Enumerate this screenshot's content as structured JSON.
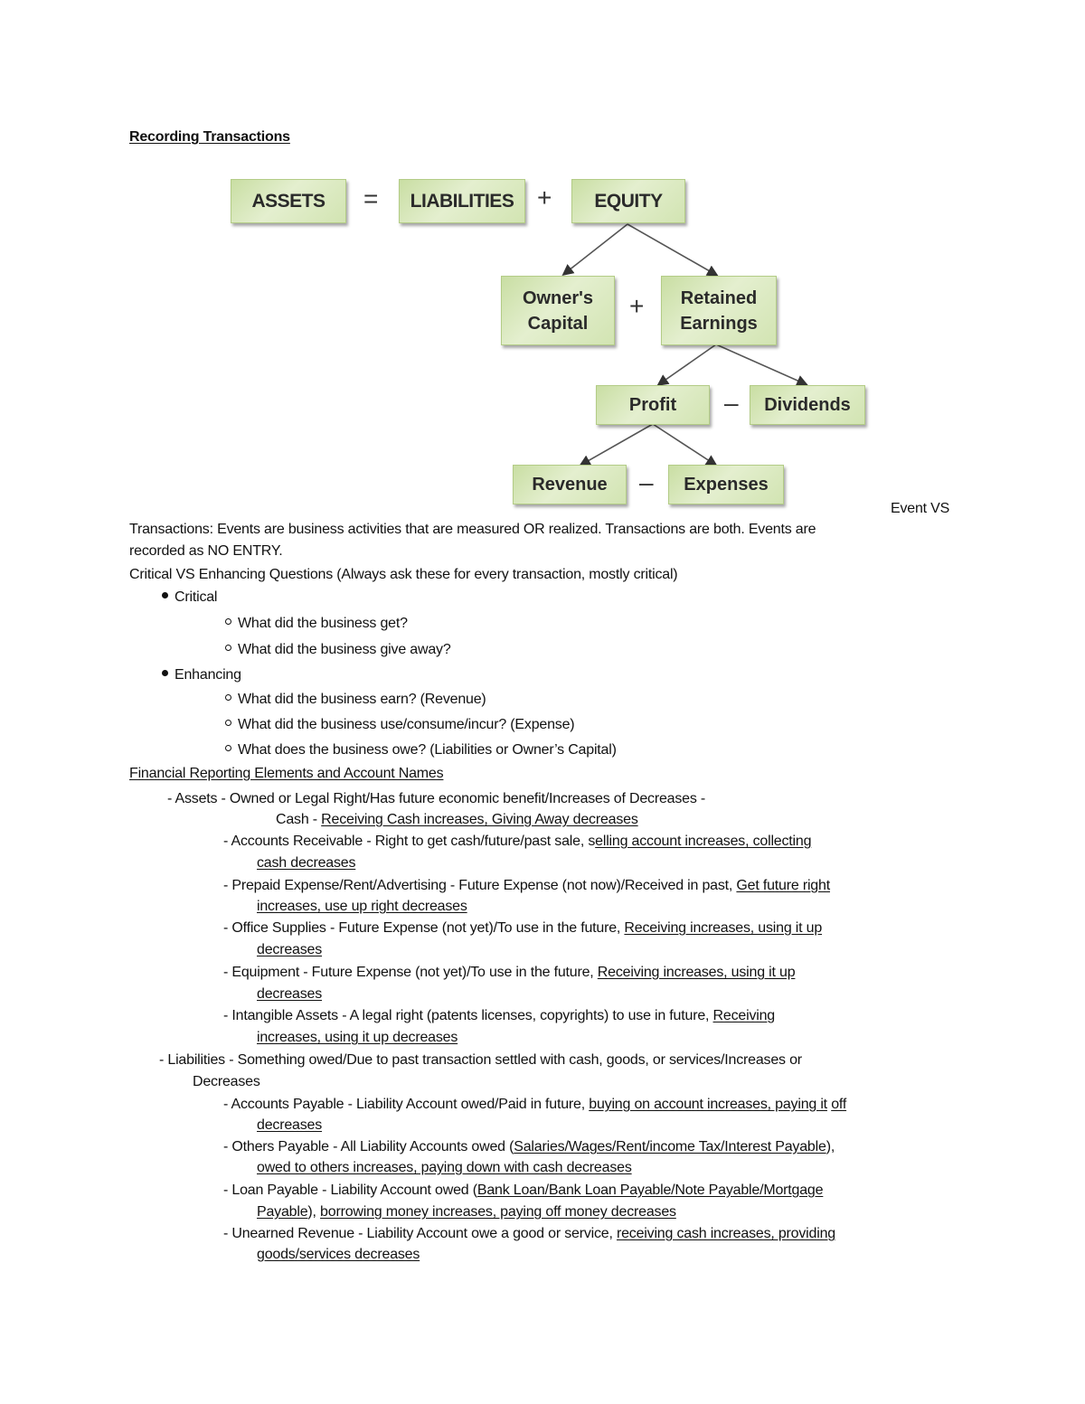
{
  "document": {
    "title": "Recording Transactions",
    "diagram": {
      "colors": {
        "box_fill": "#d9e8bd",
        "box_border": "#b3cc86",
        "arrow": "#555555"
      },
      "row1": {
        "assets": "ASSETS",
        "eq": "=",
        "liabilities": "LIABILITIES",
        "plus": "+",
        "equity": "EQUITY"
      },
      "row2": {
        "owners_capital_line1": "Owner's",
        "owners_capital_line2": "Capital",
        "plus": "+",
        "retained_line1": "Retained",
        "retained_line2": "Earnings"
      },
      "row3": {
        "profit": "Profit",
        "minus": "–",
        "dividends": "Dividends"
      },
      "row4": {
        "revenue": "Revenue",
        "minus": "–",
        "expenses": "Expenses"
      }
    },
    "event_vs_heading": "Event VS",
    "event_paragraph_line1": "Transactions: Events are business activities that are measured OR realized. Transactions are both. Events are",
    "event_paragraph_line2": "recorded as NO ENTRY.",
    "questions_heading": "Critical VS Enhancing Questions (Always ask these for every transaction, mostly critical)",
    "questions": [
      {
        "label": "Critical",
        "items": [
          "What did the business get?",
          "What did the business give away?"
        ]
      },
      {
        "label": "Enhancing",
        "items": [
          "What did the business earn? (Revenue)",
          "What did the business use/consume/incur? (Expense)",
          "What does the business owe? (Liabilities or Owner’s Capital)"
        ]
      }
    ],
    "elements_heading": "Financial Reporting Elements and Account Names",
    "assets": {
      "line": "- Assets - Owned or Legal Right/Has future economic benefit/Increases of Decreases -",
      "cash_prefix": "Cash - ",
      "cash_underlined": "Receiving Cash increases, Giving Away decreases",
      "accounts": [
        {
          "prefix": "- Accounts Receivable - Right to get cash/future/past sale, s",
          "u1": "elling account increases, collecting",
          "u2": "cash decreases"
        },
        {
          "prefix": "- Prepaid Expense/Rent/Advertising - Future Expense (not now)/Received in past, ",
          "u1": "Get future right",
          "u2": "increases, use up right decreases"
        },
        {
          "prefix": "- Office Supplies - Future Expense (not yet)/To use in the future, ",
          "u1": "Receiving increases, using it up",
          "u2": "decreases"
        },
        {
          "prefix": "- Equipment - Future Expense (not yet)/To use in the future, ",
          "u1": "Receiving increases, using it up",
          "u2": "decreases"
        },
        {
          "prefix": "- Intangible Assets - A legal right (patents licenses, copyrights) to use in future, ",
          "u1": "Receiving",
          "u2": "increases, using it up decreases"
        }
      ]
    },
    "liabilities": {
      "line1": "- Liabilities - Something owed/Due to past transaction settled with cash, goods, or services/Increases or",
      "line2": "Decreases",
      "accounts_payable": {
        "prefix": "- Accounts Payable - Liability Account owed/Paid in future, ",
        "u1": "buying on account increases, paying it",
        "sep": " ",
        "u1b": "off",
        "u2": "decreases"
      },
      "others_payable": {
        "prefix": "- Others Payable - All Liability Accounts owed (",
        "u1": "Salaries/Wages/Rent/income Tax/Interest Payable",
        "suffix": "),",
        "u2": "owed to others increases, paying down with cash decreases"
      },
      "loan_payable": {
        "prefix": "- Loan Payable - Liability Account owed (",
        "u1": "Bank Loan/Bank Loan Payable/Note Payable/Mortgage",
        "u2a": "Payable",
        "mid": "), ",
        "u2b": "borrowing money increases, paying off money decreases"
      },
      "unearned_revenue": {
        "prefix": "- Unearned Revenue - Liability Account owe a good or service, ",
        "u1": "receiving cash increases, providing",
        "u2": "goods/services decreases"
      }
    }
  }
}
